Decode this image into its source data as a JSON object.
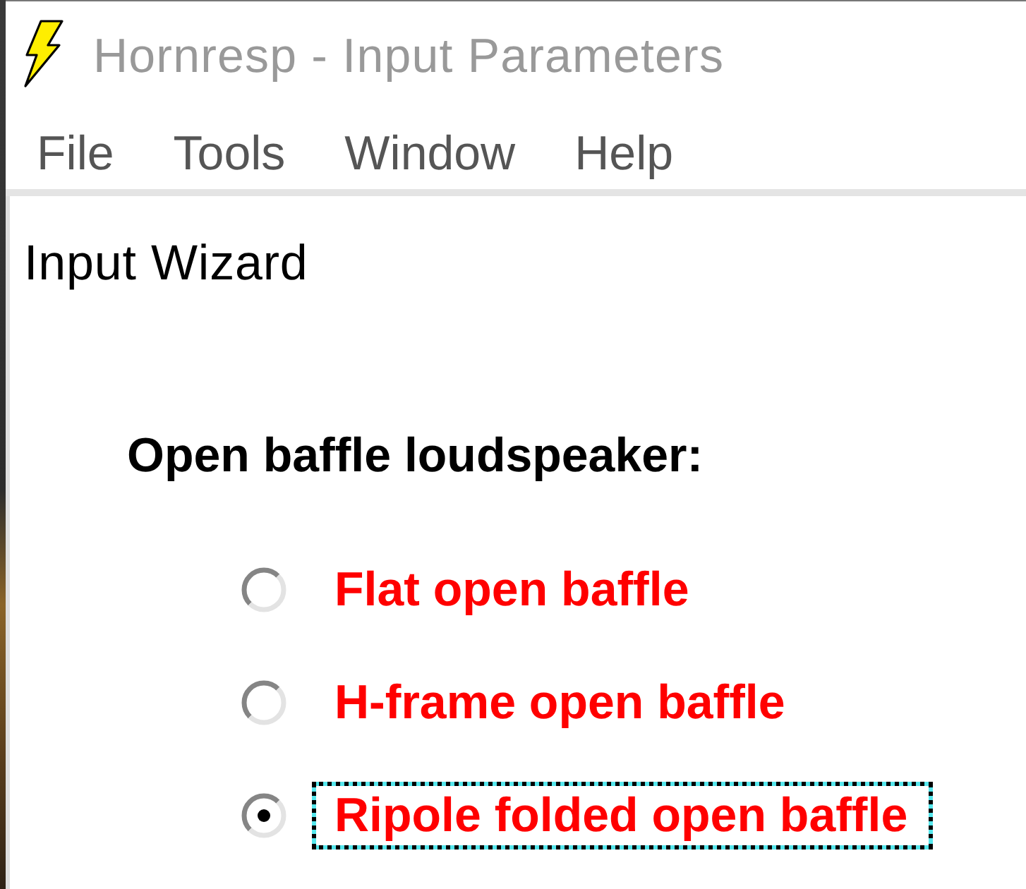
{
  "window": {
    "title": "Hornresp - Input Parameters"
  },
  "menu": [
    "File",
    "Tools",
    "Window",
    "Help"
  ],
  "wizard": {
    "heading": "Input Wizard",
    "prompt": "Open baffle loudspeaker:",
    "options": [
      {
        "label": "Flat open baffle",
        "selected": false,
        "focused": false
      },
      {
        "label": "H-frame open baffle",
        "selected": false,
        "focused": false
      },
      {
        "label": "Ripole folded open baffle",
        "selected": true,
        "focused": true
      }
    ]
  }
}
